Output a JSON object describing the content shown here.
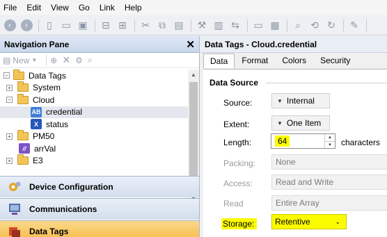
{
  "menu": {
    "file": "File",
    "edit": "Edit",
    "view": "View",
    "go": "Go",
    "link": "Link",
    "help": "Help"
  },
  "nav": {
    "title": "Navigation Pane",
    "new_label": "New",
    "tree": [
      {
        "label": "Data Tags",
        "kind": "folder-root"
      },
      {
        "label": "System",
        "kind": "folder"
      },
      {
        "label": "Cloud",
        "kind": "folder"
      },
      {
        "label": "credential",
        "kind": "tag-ab",
        "badge": "AB"
      },
      {
        "label": "status",
        "kind": "tag-x",
        "badge": "X"
      },
      {
        "label": "PM50",
        "kind": "folder"
      },
      {
        "label": "arrVal",
        "kind": "tag-arr",
        "badge": "//"
      },
      {
        "label": "E3",
        "kind": "folder"
      }
    ],
    "sections": {
      "device": "Device Configuration",
      "comms": "Communications",
      "datatags": "Data Tags"
    }
  },
  "panel": {
    "title": "Data Tags - Cloud.credential",
    "tabs": [
      "Data",
      "Format",
      "Colors",
      "Security"
    ],
    "section_title": "Data Source",
    "source_label": "Source:",
    "source_value": "Internal",
    "extent_label": "Extent:",
    "extent_value": "One Item",
    "length_label": "Length:",
    "length_value": "64",
    "length_unit": "characters",
    "packing_label": "Packing:",
    "packing_value": "None",
    "access_label": "Access:",
    "access_value": "Read and Write",
    "read_label": "Read",
    "read_value": "Entire Array",
    "storage_label": "Storage:",
    "storage_value": "Retentive"
  },
  "colors": {
    "highlight": "#fcfc00",
    "active_section": "#f5b945",
    "tag_ab": "#3f7dd6",
    "tag_x": "#2457b8",
    "tag_arr": "#7b52c7"
  }
}
